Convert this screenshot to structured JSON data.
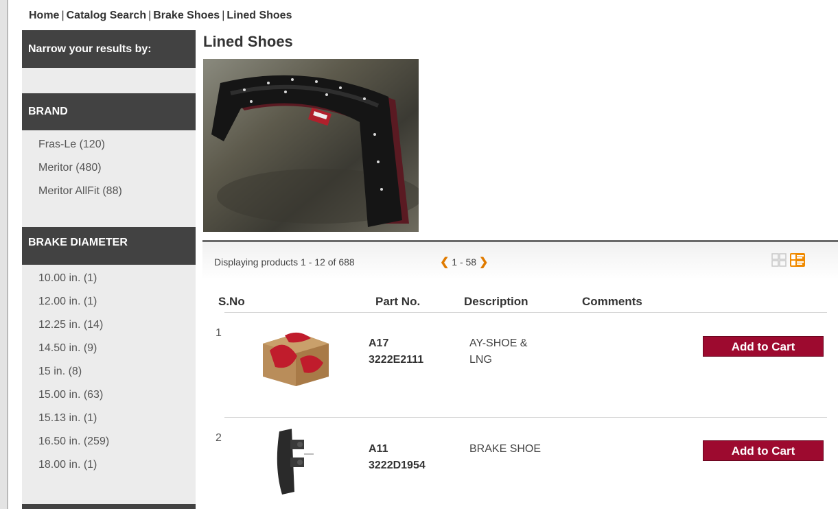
{
  "breadcrumb": {
    "items": [
      "Home",
      "Catalog Search",
      "Brake Shoes",
      "Lined Shoes"
    ],
    "separator": "|"
  },
  "sidebar": {
    "narrow_title": "Narrow your results by:",
    "brand": {
      "title": "BRAND",
      "items": [
        "Fras-Le (120)",
        "Meritor (480)",
        "Meritor AllFit (88)"
      ]
    },
    "brake_diameter": {
      "title": "BRAKE DIAMETER",
      "items": [
        "10.00 in. (1)",
        "12.00 in. (1)",
        "12.25 in. (14)",
        "14.50 in. (9)",
        "15 in. (8)",
        "15.00 in. (63)",
        "15.13 in. (1)",
        "16.50 in. (259)",
        "18.00 in. (1)"
      ]
    }
  },
  "main": {
    "title": "Lined Shoes",
    "hero_image": "lined-brake-shoe-photo",
    "displaying": "Displaying products 1 - 12 of 688",
    "pager": {
      "prev_icon": "chevron-left-icon",
      "range": "1 - 58",
      "next_icon": "chevron-right-icon"
    },
    "view_icons": [
      "grid-view-icon",
      "list-view-icon"
    ],
    "columns": {
      "sno": "S.No",
      "part_no": "Part No.",
      "description": "Description",
      "comments": "Comments"
    },
    "products": [
      {
        "sno": "1",
        "part_line1": "A17",
        "part_line2": "3222E2111",
        "desc_line1": "AY-SHOE &",
        "desc_line2": "LNG",
        "image": "product-box-image",
        "button": "Add to Cart"
      },
      {
        "sno": "2",
        "part_line1": "A11",
        "part_line2": "3222D1954",
        "desc_line1": "BRAKE SHOE",
        "desc_line2": "",
        "image": "brake-shoe-image",
        "button": "Add to Cart"
      }
    ]
  },
  "colors": {
    "accent": "#9d0a2f",
    "header_dark": "#424242",
    "pager_arrow": "#e07b00",
    "sidebar_bg": "#ececec"
  }
}
